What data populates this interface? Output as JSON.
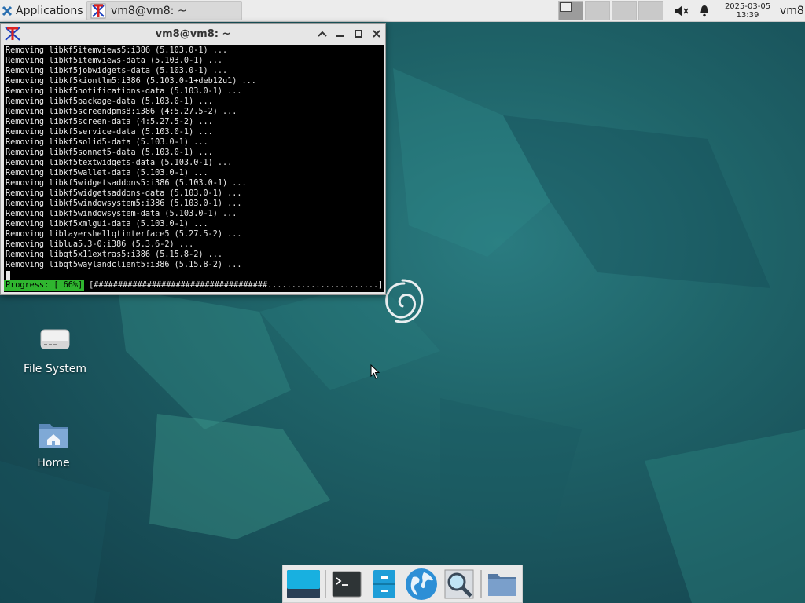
{
  "top_panel": {
    "apps_label": "Applications",
    "task_title": "vm8@vm8: ~",
    "clock_date": "2025-03-05",
    "clock_time": "13:39",
    "user": "vm8",
    "tray_icons": [
      "volume-muted-icon",
      "bell-icon"
    ]
  },
  "terminal": {
    "title": "vm8@vm8: ~",
    "lines": [
      "Removing libkf5itemviews5:i386 (5.103.0-1) ...",
      "Removing libkf5itemviews-data (5.103.0-1) ...",
      "Removing libkf5jobwidgets-data (5.103.0-1) ...",
      "Removing libkf5kiontlm5:i386 (5.103.0-1+deb12u1) ...",
      "Removing libkf5notifications-data (5.103.0-1) ...",
      "Removing libkf5package-data (5.103.0-1) ...",
      "Removing libkf5screendpms8:i386 (4:5.27.5-2) ...",
      "Removing libkf5screen-data (4:5.27.5-2) ...",
      "Removing libkf5service-data (5.103.0-1) ...",
      "Removing libkf5solid5-data (5.103.0-1) ...",
      "Removing libkf5sonnet5-data (5.103.0-1) ...",
      "Removing libkf5textwidgets-data (5.103.0-1) ...",
      "Removing libkf5wallet-data (5.103.0-1) ...",
      "Removing libkf5widgetsaddons5:i386 (5.103.0-1) ...",
      "Removing libkf5widgetsaddons-data (5.103.0-1) ...",
      "Removing libkf5windowsystem5:i386 (5.103.0-1) ...",
      "Removing libkf5windowsystem-data (5.103.0-1) ...",
      "Removing libkf5xmlgui-data (5.103.0-1) ...",
      "Removing liblayershellqtinterface5 (5.27.5-2) ...",
      "Removing liblua5.3-0:i386 (5.3.6-2) ...",
      "Removing libqt5x11extras5:i386 (5.15.8-2) ...",
      "Removing libqt5waylandclient5:i386 (5.15.8-2) ..."
    ],
    "progress_label": "Progress: [ 66%]",
    "progress_bar": "[####################################.......................]",
    "progress_fraction": 0.66
  },
  "desktop_icons": [
    {
      "label": "File System",
      "icon": "drive-icon"
    },
    {
      "label": "Home",
      "icon": "home-folder-icon"
    }
  ],
  "dock": {
    "items": [
      "show-desktop-icon",
      "terminal-icon",
      "file-manager-icon",
      "web-browser-icon",
      "app-finder-icon",
      "folder-icon"
    ]
  }
}
